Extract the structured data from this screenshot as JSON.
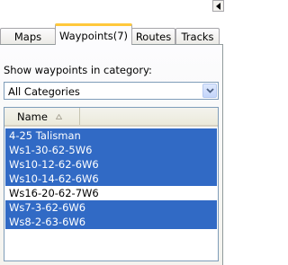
{
  "tabs": [
    {
      "label": "Maps",
      "active": false
    },
    {
      "label": "Waypoints(7)",
      "active": true
    },
    {
      "label": "Routes",
      "active": false
    },
    {
      "label": "Tracks",
      "active": false
    }
  ],
  "waypoints_panel": {
    "category_label": "Show waypoints in category:",
    "category_select": {
      "value": "All Categories"
    },
    "list": {
      "columns": [
        {
          "label": "Name",
          "sort": "ascending"
        }
      ],
      "rows": [
        {
          "name": "4-25 Talisman",
          "selected": true
        },
        {
          "name": "Ws1-30-62-5W6",
          "selected": true
        },
        {
          "name": "Ws10-12-62-6W6",
          "selected": true
        },
        {
          "name": "Ws10-14-62-6W6",
          "selected": true
        },
        {
          "name": "Ws16-20-62-7W6",
          "selected": false
        },
        {
          "name": "Ws7-3-62-6W6",
          "selected": true
        },
        {
          "name": "Ws8-2-63-6W6",
          "selected": true
        }
      ]
    }
  },
  "colors": {
    "selection_bg": "#316ac5",
    "selection_text": "#ffffff",
    "active_tab_accent": "#ffc83c"
  },
  "icons": {
    "tab_scroll": "triangle-left-icon",
    "combo_dropdown": "chevron-down-icon",
    "sort": "sort-ascending-icon"
  }
}
